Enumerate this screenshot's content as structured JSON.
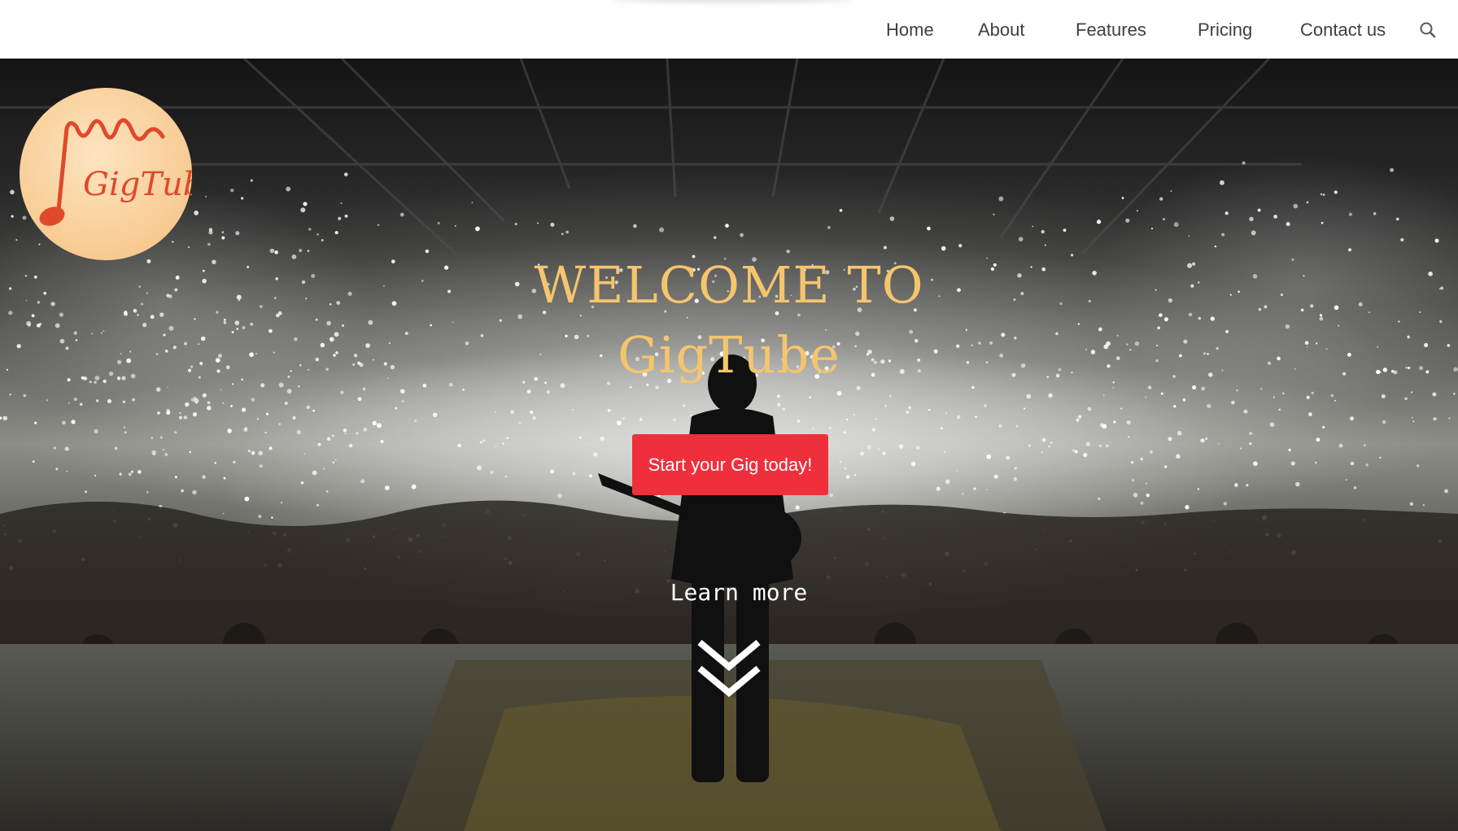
{
  "nav": {
    "items": [
      {
        "label": "Home"
      },
      {
        "label": "About"
      },
      {
        "label": "Features"
      },
      {
        "label": "Pricing"
      },
      {
        "label": "Contact us"
      }
    ],
    "search_icon": "search-icon"
  },
  "logo": {
    "text": "GigTube",
    "icon": "music-note-logo-icon"
  },
  "hero": {
    "title_line1": "WELCOME TO",
    "title_line2": "GigTube",
    "cta_label": "Start your Gig today!",
    "learn_more": "Learn more",
    "scroll_icon": "double-chevron-down-icon"
  },
  "colors": {
    "title": "#f5c56e",
    "cta": "#ef2f3c",
    "logo_bg": "#fbd8a8",
    "logo_ink": "#e0492b"
  }
}
